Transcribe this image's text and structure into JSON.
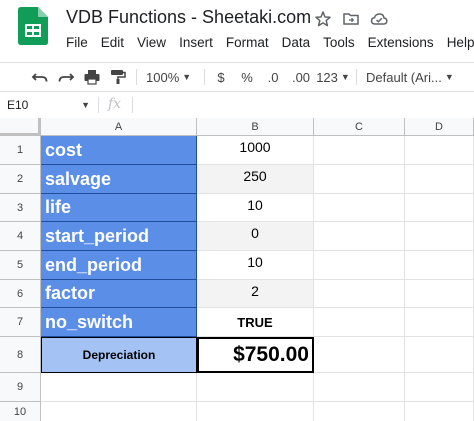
{
  "app": {
    "title": "VDB Functions - Sheetaki.com",
    "menu": [
      "File",
      "Edit",
      "View",
      "Insert",
      "Format",
      "Data",
      "Tools",
      "Extensions",
      "Help"
    ]
  },
  "toolbar": {
    "zoom": "100%",
    "currency": "$",
    "percent": "%",
    "dec_decrease": ".0",
    "dec_increase": ".00",
    "number_format": "123",
    "font": "Default (Ari..."
  },
  "formula_bar": {
    "name_box": "E10",
    "fx": "fx",
    "formula": ""
  },
  "sheet": {
    "columns": [
      "A",
      "B",
      "C",
      "D"
    ],
    "rows": [
      "1",
      "2",
      "3",
      "4",
      "5",
      "6",
      "7",
      "8",
      "9",
      "10"
    ],
    "labels": [
      "cost",
      "salvage",
      "life",
      "start_period",
      "end_period",
      "factor",
      "no_switch"
    ],
    "values": [
      "1000",
      "250",
      "10",
      "0",
      "10",
      "2",
      "TRUE"
    ],
    "result_label": "Depreciation",
    "result_value": "$750.00"
  },
  "colors": {
    "label_fill": "#5b8ee6",
    "result_label_fill": "#a4c2f4",
    "sheets_green": "#0f9d58"
  }
}
